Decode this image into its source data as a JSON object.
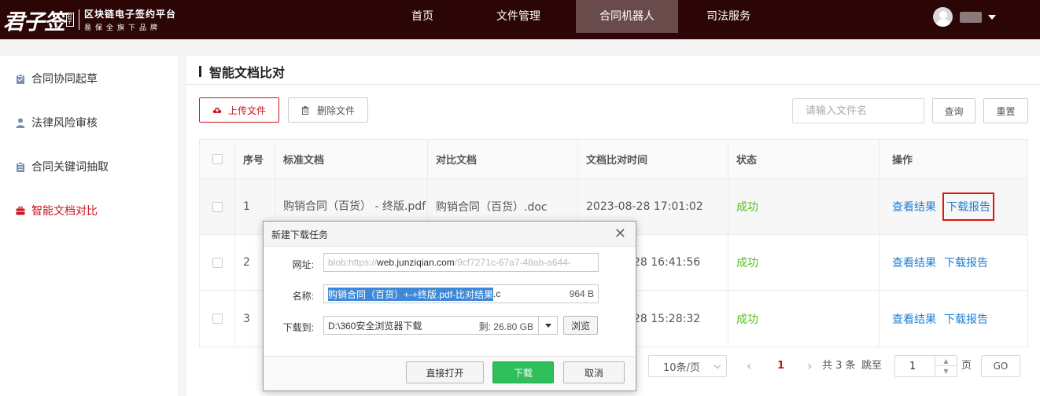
{
  "header": {
    "logo_main": "君子签",
    "logo_seal": "君子",
    "logo_line1": "区块链电子签约平台",
    "logo_line2": "易保全旗下品牌",
    "nav": [
      {
        "label": "首页",
        "active": false
      },
      {
        "label": "文件管理",
        "active": false
      },
      {
        "label": "合同机器人",
        "active": true
      },
      {
        "label": "司法服务",
        "active": false
      }
    ]
  },
  "sidebar": {
    "items": [
      {
        "label": "合同协同起草",
        "icon": "clipboard-icon",
        "active": false
      },
      {
        "label": "法律风险审核",
        "icon": "user-icon",
        "active": false
      },
      {
        "label": "合同关键词抽取",
        "icon": "clipboard-icon",
        "active": false
      },
      {
        "label": "智能文档对比",
        "icon": "briefcase-icon",
        "active": true
      }
    ]
  },
  "main": {
    "title": "智能文档比对",
    "toolbar": {
      "upload_label": "上传文件",
      "delete_label": "删除文件",
      "search_placeholder": "请输入文件名",
      "query_label": "查询",
      "reset_label": "重置"
    },
    "table": {
      "columns": [
        "序号",
        "标准文档",
        "对比文档",
        "文档比对时间",
        "状态",
        "操作"
      ],
      "rows": [
        {
          "no": "1",
          "standard": "购销合同（百货） - 终版.pdf",
          "compare": "购销合同（百货）.doc",
          "time": "2023-08-28 17:01:02",
          "status": "成功",
          "view": "查看结果",
          "download": "下载报告"
        },
        {
          "no": "2",
          "standard": "",
          "compare": "",
          "time": "28 16:41:56",
          "status": "成功",
          "view": "查看结果",
          "download": "下载报告"
        },
        {
          "no": "3",
          "standard": "",
          "compare": "",
          "time": "28 15:28:32",
          "status": "成功",
          "view": "查看结果",
          "download": "下载报告"
        }
      ]
    },
    "pagination": {
      "page_size": "10条/页",
      "current_page": "1",
      "total": "共 3 条",
      "jump_label": "跳至",
      "jump_value": "1",
      "page_unit": "页",
      "go_label": "GO"
    }
  },
  "dialog": {
    "title": "新建下载任务",
    "url_label": "网址:",
    "url_prefix": "blob:https://",
    "url_host": "web.junziqian.com",
    "url_suffix": "/9cf7271c-67a7-48ab-a644-",
    "name_label": "名称:",
    "name_selected": "购销合同（百货）+-+终版.pdf-比对结果",
    "name_rest": ".c",
    "name_size": "964 B",
    "path_label": "下载到:",
    "path_value": "D:\\360安全浏览器下载",
    "path_free": "剩: 26.80 GB",
    "browse_label": "浏览",
    "open_label": "直接打开",
    "download_label": "下载",
    "cancel_label": "取消"
  }
}
